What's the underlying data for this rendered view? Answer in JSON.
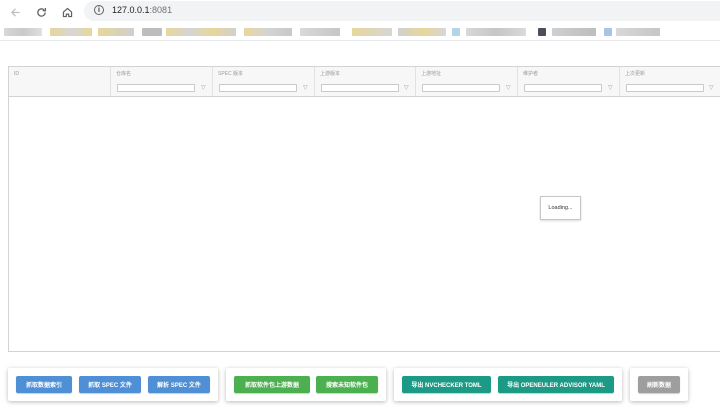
{
  "browser": {
    "url_host": "127.0.0.1",
    "url_port": ":8081"
  },
  "grid": {
    "columns": [
      {
        "label": "ID"
      },
      {
        "label": "仓库名"
      },
      {
        "label": "SPEC 版本"
      },
      {
        "label": "上游版本"
      },
      {
        "label": "上游地址"
      },
      {
        "label": "维护者"
      },
      {
        "label": "上次更新"
      }
    ],
    "loading_text": "Loading..."
  },
  "actions": {
    "fetch_index": "抓取数据索引",
    "fetch_spec": "抓取 SPEC 文件",
    "parse_spec": "解析 SPEC 文件",
    "fetch_upstream": "抓取软件包上游数据",
    "search_unknown": "搜索未知软件包",
    "export_nvchecker": "导出 NVCHECKER TOML",
    "export_advisor": "导出 OPENEULER ADVISOR YAML",
    "refresh": "刷新数据"
  },
  "colors": {
    "blue": "#4f8fd6",
    "green": "#4caf50",
    "teal": "#1d9a86",
    "grey": "#9e9e9e"
  }
}
